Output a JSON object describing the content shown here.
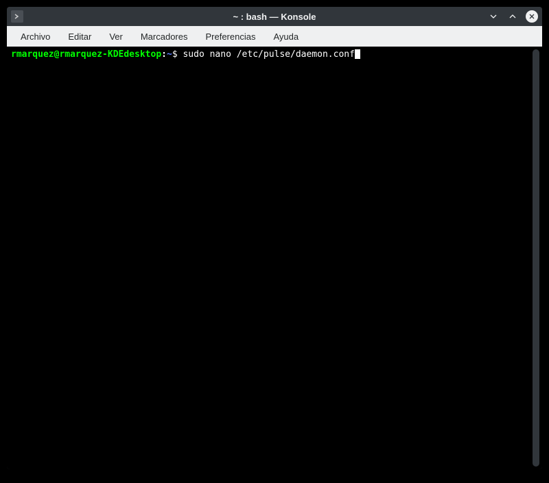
{
  "window": {
    "title": "~ : bash — Konsole"
  },
  "menubar": {
    "items": [
      {
        "label": "Archivo"
      },
      {
        "label": "Editar"
      },
      {
        "label": "Ver"
      },
      {
        "label": "Marcadores"
      },
      {
        "label": "Preferencias"
      },
      {
        "label": "Ayuda"
      }
    ]
  },
  "terminal": {
    "prompt_user_host": "rmarquez@rmarquez-KDEdesktop",
    "prompt_separator": ":",
    "prompt_path": "~",
    "prompt_symbol": "$",
    "command": " sudo nano /etc/pulse/daemon.conf"
  }
}
